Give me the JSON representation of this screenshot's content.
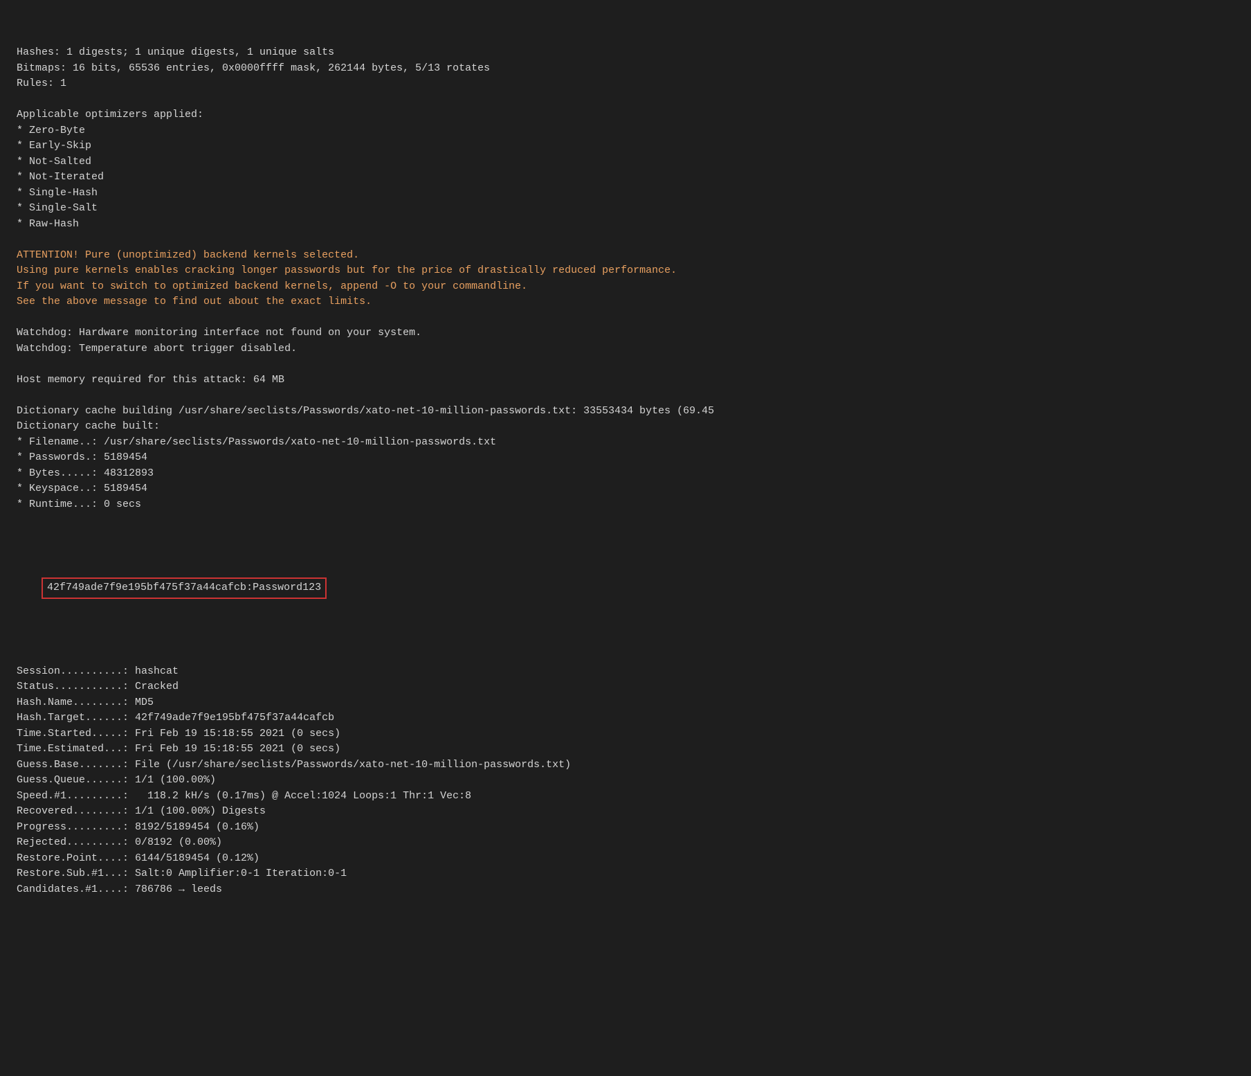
{
  "terminal": {
    "lines": [
      {
        "text": "Hashes: 1 digests; 1 unique digests, 1 unique salts",
        "style": "normal"
      },
      {
        "text": "Bitmaps: 16 bits, 65536 entries, 0x0000ffff mask, 262144 bytes, 5/13 rotates",
        "style": "normal"
      },
      {
        "text": "Rules: 1",
        "style": "normal"
      },
      {
        "text": "",
        "style": "empty"
      },
      {
        "text": "Applicable optimizers applied:",
        "style": "normal"
      },
      {
        "text": "* Zero-Byte",
        "style": "normal"
      },
      {
        "text": "* Early-Skip",
        "style": "normal"
      },
      {
        "text": "* Not-Salted",
        "style": "normal"
      },
      {
        "text": "* Not-Iterated",
        "style": "normal"
      },
      {
        "text": "* Single-Hash",
        "style": "normal"
      },
      {
        "text": "* Single-Salt",
        "style": "normal"
      },
      {
        "text": "* Raw-Hash",
        "style": "normal"
      },
      {
        "text": "",
        "style": "empty"
      },
      {
        "text": "ATTENTION! Pure (unoptimized) backend kernels selected.",
        "style": "orange"
      },
      {
        "text": "Using pure kernels enables cracking longer passwords but for the price of drastically reduced performance.",
        "style": "orange"
      },
      {
        "text": "If you want to switch to optimized backend kernels, append -O to your commandline.",
        "style": "orange"
      },
      {
        "text": "See the above message to find out about the exact limits.",
        "style": "orange"
      },
      {
        "text": "",
        "style": "empty"
      },
      {
        "text": "Watchdog: Hardware monitoring interface not found on your system.",
        "style": "normal"
      },
      {
        "text": "Watchdog: Temperature abort trigger disabled.",
        "style": "normal"
      },
      {
        "text": "",
        "style": "empty"
      },
      {
        "text": "Host memory required for this attack: 64 MB",
        "style": "normal"
      },
      {
        "text": "",
        "style": "empty"
      },
      {
        "text": "Dictionary cache building /usr/share/seclists/Passwords/xato-net-10-million-passwords.txt: 33553434 bytes (69.45",
        "style": "normal"
      },
      {
        "text": "Dictionary cache built:",
        "style": "normal"
      },
      {
        "text": "* Filename..: /usr/share/seclists/Passwords/xato-net-10-million-passwords.txt",
        "style": "normal"
      },
      {
        "text": "* Passwords.: 5189454",
        "style": "normal"
      },
      {
        "text": "* Bytes.....: 48312893",
        "style": "normal"
      },
      {
        "text": "* Keyspace..: 5189454",
        "style": "normal"
      },
      {
        "text": "* Runtime...: 0 secs",
        "style": "normal"
      },
      {
        "text": "",
        "style": "empty"
      }
    ],
    "cracked_result": "42f749ade7f9e195bf475f37a44cafcb:Password123",
    "session_lines": [
      {
        "text": "",
        "style": "empty"
      },
      {
        "text": "Session..........: hashcat",
        "style": "normal"
      },
      {
        "text": "Status...........: Cracked",
        "style": "normal"
      },
      {
        "text": "Hash.Name........: MD5",
        "style": "normal"
      },
      {
        "text": "Hash.Target......: 42f749ade7f9e195bf475f37a44cafcb",
        "style": "normal"
      },
      {
        "text": "Time.Started.....: Fri Feb 19 15:18:55 2021 (0 secs)",
        "style": "normal"
      },
      {
        "text": "Time.Estimated...: Fri Feb 19 15:18:55 2021 (0 secs)",
        "style": "normal"
      },
      {
        "text": "Guess.Base.......: File (/usr/share/seclists/Passwords/xato-net-10-million-passwords.txt)",
        "style": "normal"
      },
      {
        "text": "Guess.Queue......: 1/1 (100.00%)",
        "style": "normal"
      },
      {
        "text": "Speed.#1.........:   118.2 kH/s (0.17ms) @ Accel:1024 Loops:1 Thr:1 Vec:8",
        "style": "normal"
      },
      {
        "text": "Recovered........: 1/1 (100.00%) Digests",
        "style": "normal"
      },
      {
        "text": "Progress.........: 8192/5189454 (0.16%)",
        "style": "normal"
      },
      {
        "text": "Rejected.........: 0/8192 (0.00%)",
        "style": "normal"
      },
      {
        "text": "Restore.Point....: 6144/5189454 (0.12%)",
        "style": "normal"
      },
      {
        "text": "Restore.Sub.#1...: Salt:0 Amplifier:0-1 Iteration:0-1",
        "style": "normal"
      },
      {
        "text": "Candidates.#1....: 786786 → leeds",
        "style": "normal"
      }
    ]
  }
}
